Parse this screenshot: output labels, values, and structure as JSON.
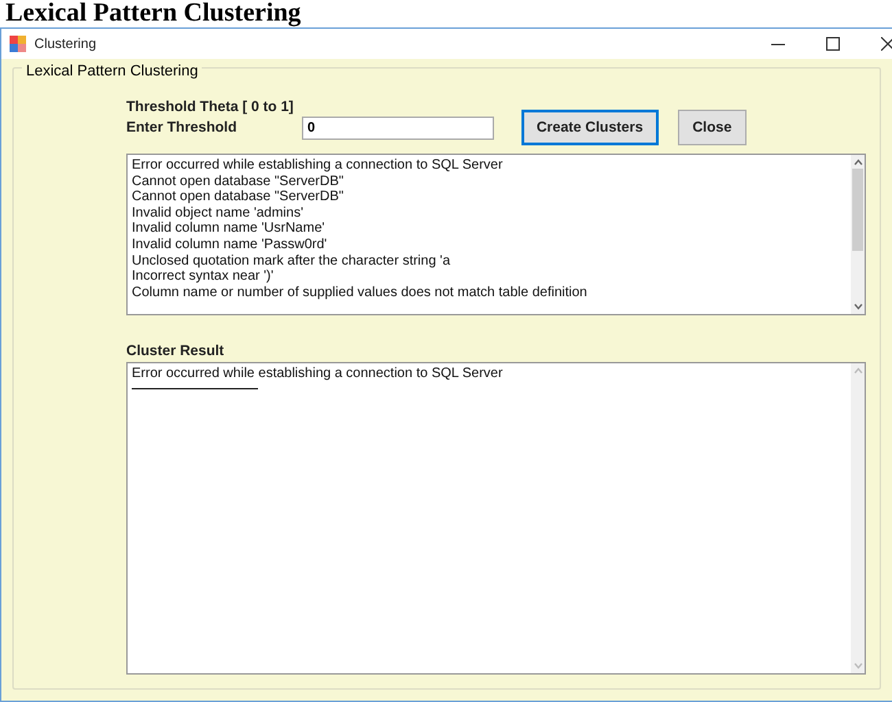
{
  "page_heading": "Lexical Pattern Clustering",
  "window": {
    "title": "Clustering"
  },
  "group": {
    "title": "Lexical Pattern Clustering",
    "threshold_hint": "Threshold Theta [ 0 to 1]",
    "threshold_label": "Enter Threshold",
    "threshold_value": "0",
    "buttons": [
      {
        "label": "Create Clusters",
        "focused": true
      },
      {
        "label": "Close",
        "focused": false
      }
    ],
    "messages": [
      "Error occurred while establishing a connection to SQL Server",
      "Cannot open database \"ServerDB\"",
      "Cannot open database \"ServerDB\"",
      "Invalid object name 'admins'",
      "Invalid column name 'UsrName'",
      "Invalid column name 'Passw0rd'",
      "Unclosed quotation mark after the character string 'a",
      "Incorrect syntax near ')'",
      "Column name or number of supplied values does not match table definition"
    ],
    "result_label": "Cluster Result",
    "results": [
      "Error occurred while establishing a connection to SQL Server"
    ]
  }
}
